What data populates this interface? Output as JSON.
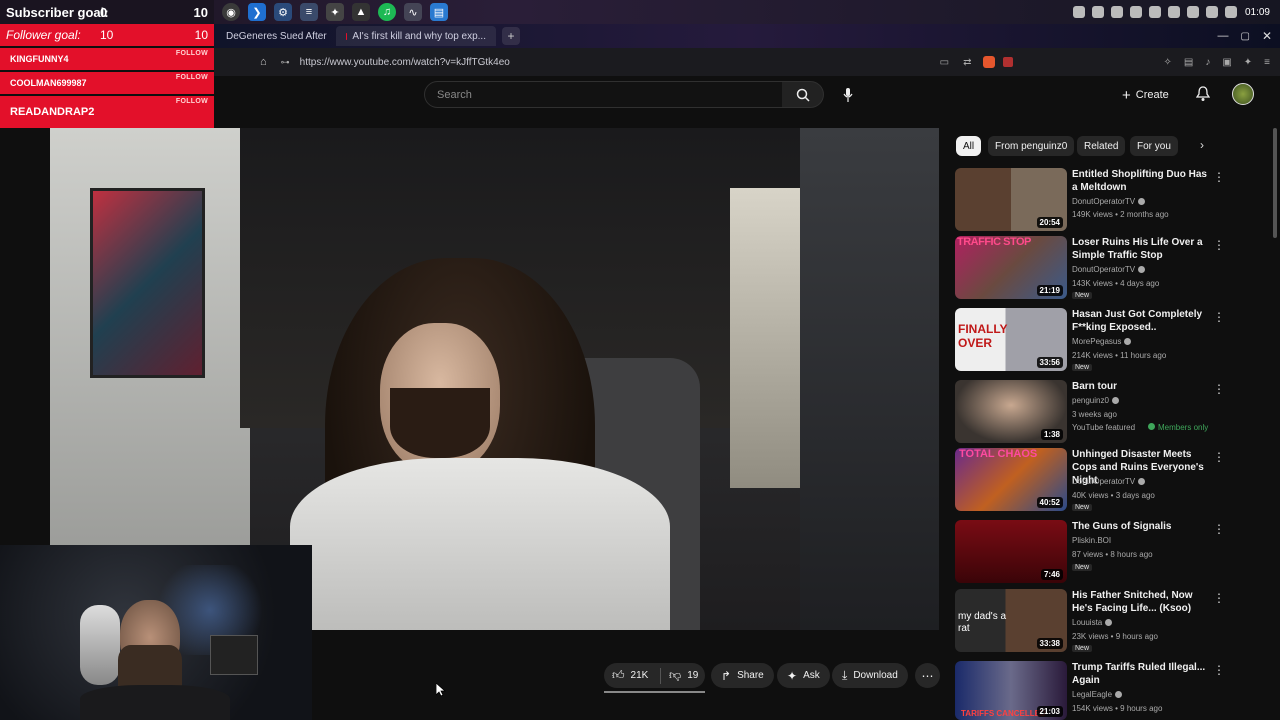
{
  "overlay": {
    "subscriber_label": "Subscriber goal:",
    "subscriber_current": "0",
    "subscriber_target": "10",
    "follower_label": "Follower goal:",
    "follower_current": "10",
    "follower_target": "10",
    "follow_tag": "FOLLOW",
    "followers": [
      "KINGFUNNY4",
      "COOLMAN699987",
      "READANDRAP2"
    ]
  },
  "os": {
    "clock": "01:09"
  },
  "browser": {
    "tabs": [
      "DeGeneres Sued After",
      "AI's first kill and why top exp..."
    ],
    "new_tab": "+",
    "url": "https://www.youtube.com/watch?v=kJffTGtk4eo"
  },
  "youtube": {
    "search_placeholder": "Search",
    "create_label": "Create",
    "chips": [
      "All",
      "From penguinz0",
      "Related",
      "For you"
    ],
    "actions": {
      "like_count": "21K",
      "dislike_count": "19",
      "share": "Share",
      "ask": "Ask",
      "download": "Download"
    }
  },
  "recommendations": [
    {
      "title": "Entitled Shoplifting Duo Has a Meltdown",
      "channel": "DonutOperatorTV",
      "meta": "149K views • 2 months ago",
      "duration": "20:54",
      "badge": "",
      "thumb_color": "#6b5a4a"
    },
    {
      "title": "Loser Ruins His Life Over a Simple Traffic Stop",
      "channel": "DonutOperatorTV",
      "meta": "143K views • 4 days ago",
      "duration": "21:19",
      "badge": "New",
      "thumb_color": "#7a4a6a",
      "thumb_text": "TRAFFIC STOP"
    },
    {
      "title": "Hasan Just Got Completely F**king Exposed..",
      "channel": "MorePegasus",
      "meta": "214K views • 11 hours ago",
      "duration": "33:56",
      "badge": "New",
      "thumb_color": "#8a3030",
      "thumb_text": "FINALLY OVER"
    },
    {
      "title": "Barn tour",
      "channel": "penguinz0",
      "meta": "3 weeks ago",
      "duration": "1:38",
      "badge": "",
      "featured": "YouTube featured",
      "members": "Members only",
      "thumb_color": "#4a4440"
    },
    {
      "title": "Unhinged Disaster Meets Cops and Ruins Everyone's Night",
      "channel": "DonutOperatorTV",
      "meta": "40K views • 3 days ago",
      "duration": "40:52",
      "badge": "New",
      "thumb_color": "#5a2a6a",
      "thumb_text": "TOTAL CHAOS"
    },
    {
      "title": "The Guns of Signalis",
      "channel": "Pliskin.BOI",
      "meta": "87 views • 8 hours ago",
      "duration": "7:46",
      "badge": "New",
      "thumb_color": "#5a0c10"
    },
    {
      "title": "His Father Snitched, Now He's Facing Life... (Ksoo)",
      "channel": "Louuista",
      "meta": "23K views • 9 hours ago",
      "duration": "33:38",
      "badge": "New",
      "thumb_color": "#3a2a20",
      "thumb_text": "my dad's a rat"
    },
    {
      "title": "Trump Tariffs Ruled Illegal... Again",
      "channel": "LegalEagle",
      "meta": "154K views • 9 hours ago",
      "duration": "21:03",
      "badge": "",
      "thumb_color": "#1e2a5a",
      "thumb_text": "TARIFFS CANCELLED"
    }
  ],
  "colors": {
    "accent_red": "#e3102a",
    "members_green": "#3ea65a",
    "bg": "#0f0f0f"
  }
}
